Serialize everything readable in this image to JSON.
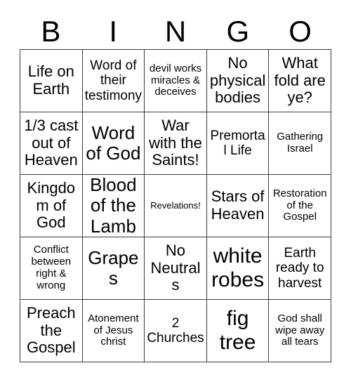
{
  "card": {
    "title_letters": [
      "B",
      "I",
      "N",
      "G",
      "O"
    ],
    "columns": 5,
    "rows": 5,
    "border_color": "#3a3a3a",
    "background_color": "#ffffff",
    "text_color": "#000000",
    "cells": [
      [
        {
          "text": "Life on Earth",
          "size": "lg"
        },
        {
          "text": "Word of their testimony",
          "size": "md"
        },
        {
          "text": "devil works miracles & deceives",
          "size": "sm"
        },
        {
          "text": "No physical bodies",
          "size": "lg"
        },
        {
          "text": "What fold are ye?",
          "size": "lg"
        }
      ],
      [
        {
          "text": "1/3 cast out of Heaven",
          "size": "lg"
        },
        {
          "text": "Word of God",
          "size": "xl"
        },
        {
          "text": "War with the Saints!",
          "size": "lg"
        },
        {
          "text": "Premortal Life",
          "size": "md"
        },
        {
          "text": "Gathering Israel",
          "size": "sm"
        }
      ],
      [
        {
          "text": "Kingdom of God",
          "size": "lg"
        },
        {
          "text": "Blood of the Lamb",
          "size": "xl"
        },
        {
          "text": "Revelations!",
          "size": "xs"
        },
        {
          "text": "Stars of Heaven",
          "size": "lg"
        },
        {
          "text": "Restoration of the Gospel",
          "size": "sm"
        }
      ],
      [
        {
          "text": "Conflict between right & wrong",
          "size": "sm"
        },
        {
          "text": "Grapes",
          "size": "xl"
        },
        {
          "text": "No Neutrals",
          "size": "lg"
        },
        {
          "text": "white robes",
          "size": "xxl"
        },
        {
          "text": "Earth ready to harvest",
          "size": "md"
        }
      ],
      [
        {
          "text": "Preach the Gospel",
          "size": "lg"
        },
        {
          "text": "Atonement of Jesus christ",
          "size": "sm"
        },
        {
          "text": "2 Churches",
          "size": "md"
        },
        {
          "text": "fig tree",
          "size": "xxl"
        },
        {
          "text": "God shall wipe away all tears",
          "size": "sm"
        }
      ]
    ]
  }
}
